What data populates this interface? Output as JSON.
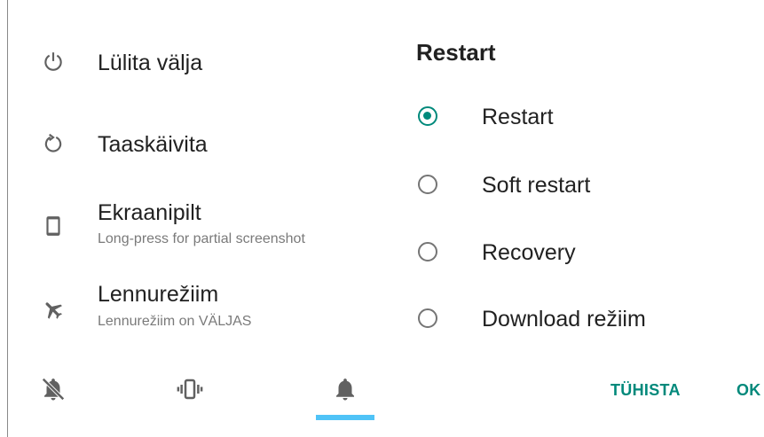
{
  "power_menu": {
    "items": [
      {
        "icon": "power-icon",
        "label": "Lülita välja"
      },
      {
        "icon": "restart-icon",
        "label": "Taaskäivita"
      },
      {
        "icon": "phone-icon",
        "label": "Ekraanipilt",
        "sub": "Long-press for partial screenshot"
      },
      {
        "icon": "airplane-icon",
        "label": "Lennurežiim",
        "sub": "Lennurežiim on VÄLJAS"
      }
    ],
    "sound_modes": [
      "mute-icon",
      "vibrate-icon",
      "bell-icon"
    ],
    "selected_mode": "bell-icon"
  },
  "dialog": {
    "title": "Restart",
    "options": [
      {
        "label": "Restart",
        "checked": true
      },
      {
        "label": "Soft restart",
        "checked": false
      },
      {
        "label": "Recovery",
        "checked": false
      },
      {
        "label": "Download režiim",
        "checked": false
      }
    ],
    "cancel_label": "TÜHISTA",
    "ok_label": "OK"
  },
  "colors": {
    "accent": "#00897b",
    "indicator": "#4fc3f7",
    "icon": "#616161"
  }
}
